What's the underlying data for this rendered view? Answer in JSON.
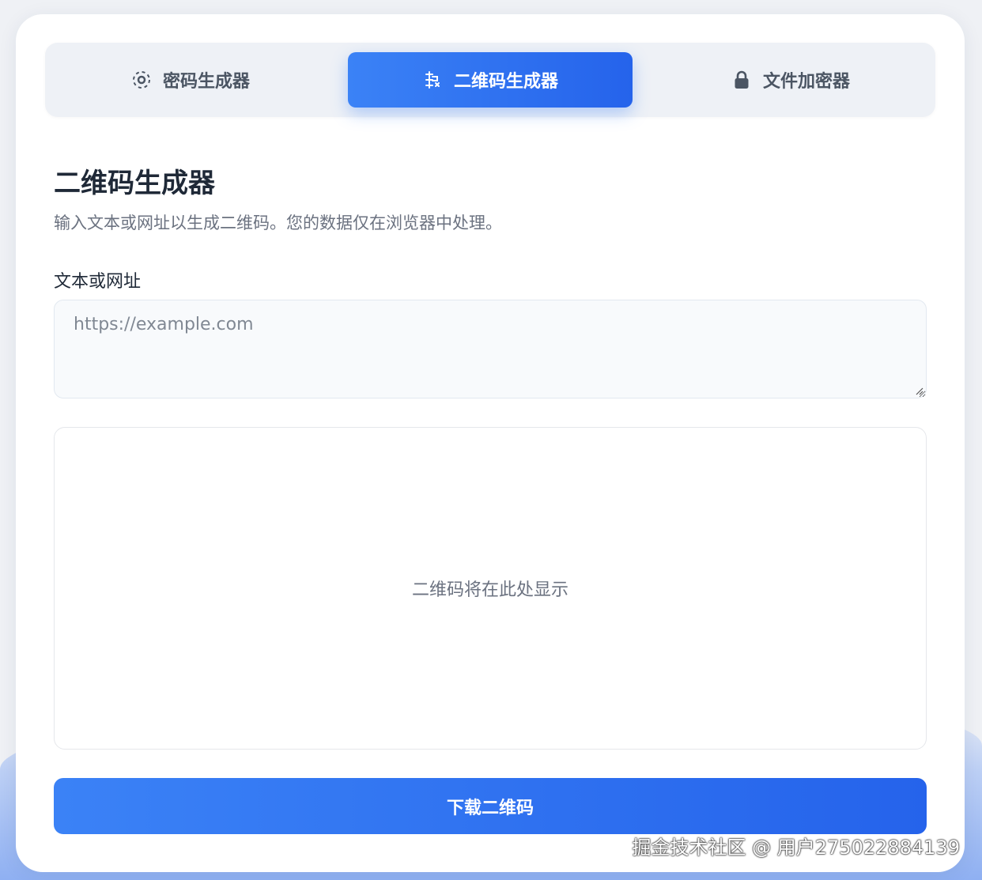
{
  "tabs": [
    {
      "label": "密码生成器",
      "icon": "password-gear-icon",
      "active": false
    },
    {
      "label": "二维码生成器",
      "icon": "qr-code-icon",
      "active": true
    },
    {
      "label": "文件加密器",
      "icon": "lock-icon",
      "active": false
    }
  ],
  "main": {
    "title": "二维码生成器",
    "subtitle": "输入文本或网址以生成二维码。您的数据仅在浏览器中处理。",
    "input_label": "文本或网址",
    "input_placeholder": "https://example.com",
    "input_value": "",
    "qr_placeholder": "二维码将在此处显示",
    "download_label": "下载二维码"
  },
  "watermark": "掘金技术社区 @ 用户2750228841​39",
  "colors": {
    "accent": "#3b82f6",
    "accent_dark": "#2563eb",
    "background": "#eff1f5",
    "card": "#ffffff"
  }
}
